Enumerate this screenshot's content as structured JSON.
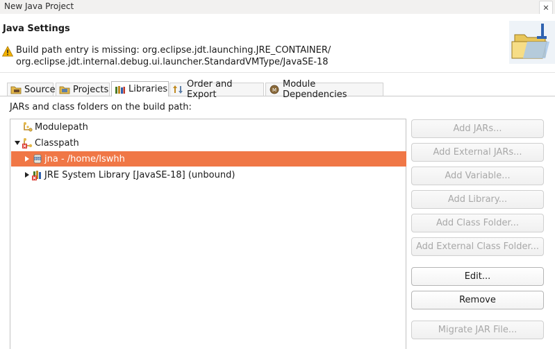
{
  "window": {
    "title": "New Java Project"
  },
  "header": {
    "title": "Java Settings",
    "warning_line1": "Build path entry is missing: org.eclipse.jdt.launching.JRE_CONTAINER/",
    "warning_line2": "org.eclipse.jdt.internal.debug.ui.launcher.StandardVMType/JavaSE-18"
  },
  "tabs": [
    {
      "label": "Source",
      "icon": "source-folder-icon"
    },
    {
      "label": "Projects",
      "icon": "projects-icon"
    },
    {
      "label": "Libraries",
      "icon": "libraries-icon",
      "active": true
    },
    {
      "label": "Order and Export",
      "icon": "order-export-icon"
    },
    {
      "label": "Module Dependencies",
      "icon": "module-icon"
    }
  ],
  "libraries": {
    "section_label": "JARs and class folders on the build path:",
    "tree": [
      {
        "label": "Modulepath",
        "level": 0,
        "expanded": null,
        "icon": "modulepath-icon"
      },
      {
        "label": "Classpath",
        "level": 0,
        "expanded": true,
        "icon": "classpath-icon"
      },
      {
        "label": "jna - /home/lswhh",
        "level": 1,
        "expanded": false,
        "icon": "jar-icon",
        "selected": true
      },
      {
        "label": "JRE System Library [JavaSE-18] (unbound)",
        "level": 1,
        "expanded": false,
        "icon": "jre-library-error-icon"
      }
    ],
    "buttons": [
      {
        "label": "Add JARs...",
        "enabled": false
      },
      {
        "label": "Add External JARs...",
        "enabled": false
      },
      {
        "label": "Add Variable...",
        "enabled": false
      },
      {
        "label": "Add Library...",
        "enabled": false
      },
      {
        "label": "Add Class Folder...",
        "enabled": false
      },
      {
        "label": "Add External Class Folder...",
        "enabled": false
      },
      {
        "label": "Edit...",
        "enabled": true
      },
      {
        "label": "Remove",
        "enabled": true
      },
      {
        "label": "Migrate JAR File...",
        "enabled": false
      }
    ]
  },
  "colors": {
    "selection": "#f07746",
    "warning": "#f5b400"
  }
}
